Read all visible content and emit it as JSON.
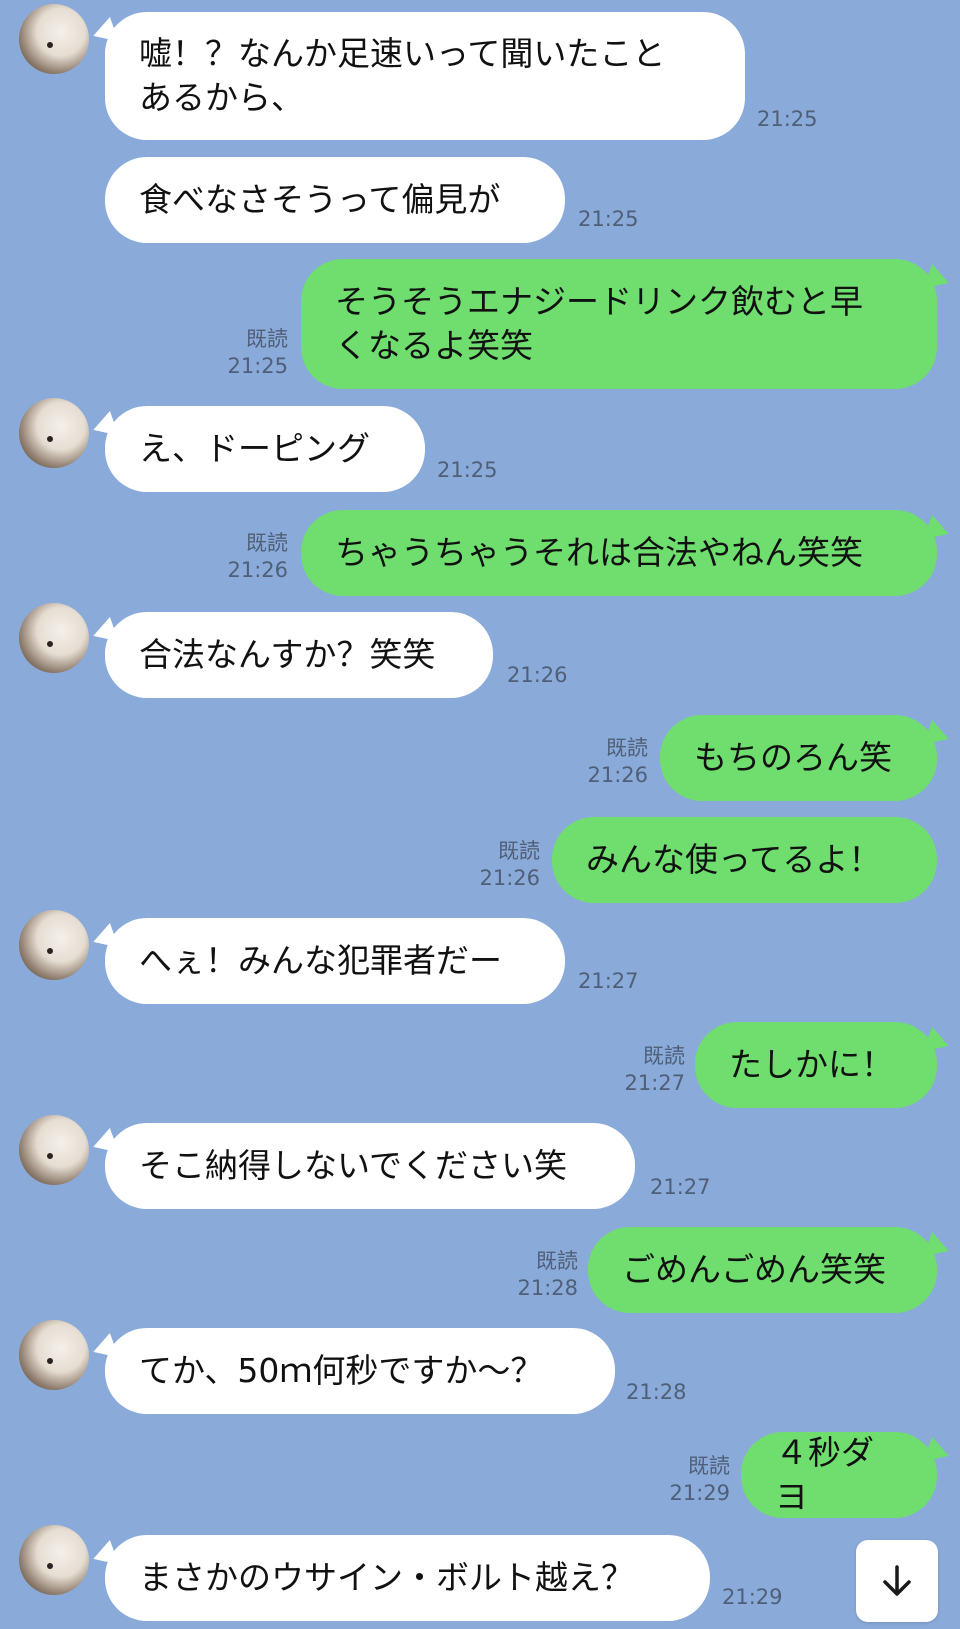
{
  "chat": {
    "messages": [
      {
        "side": "in",
        "text": "嘘！？なんか足速いって聞いたこと\nあるから、",
        "time": "21:25"
      },
      {
        "side": "in",
        "text": "食べなさそうって偏見が",
        "time": "21:25"
      },
      {
        "side": "out",
        "text": "そうそうエナジードリンク飲むと早\nくなるよ笑笑",
        "read": "既読",
        "time": "21:25"
      },
      {
        "side": "in",
        "text": "え、ドーピング",
        "time": "21:25"
      },
      {
        "side": "out",
        "text": "ちゃうちゃうそれは合法やねん笑笑",
        "read": "既読",
        "time": "21:26"
      },
      {
        "side": "in",
        "text": "合法なんすか？笑笑",
        "time": "21:26"
      },
      {
        "side": "out",
        "text": "もちのろん笑",
        "read": "既読",
        "time": "21:26"
      },
      {
        "side": "out",
        "text": "みんな使ってるよ！",
        "read": "既読",
        "time": "21:26"
      },
      {
        "side": "in",
        "text": "へぇ！みんな犯罪者だー",
        "time": "21:27"
      },
      {
        "side": "out",
        "text": "たしかに！",
        "read": "既読",
        "time": "21:27"
      },
      {
        "side": "in",
        "text": "そこ納得しないでください笑",
        "time": "21:27"
      },
      {
        "side": "out",
        "text": "ごめんごめん笑笑",
        "read": "既読",
        "time": "21:28"
      },
      {
        "side": "in",
        "text": "てか、50ｍ何秒ですか〜？",
        "time": "21:28"
      },
      {
        "side": "out",
        "text": "４秒ダヨ",
        "read": "既読",
        "time": "21:29"
      },
      {
        "side": "in",
        "text": "まさかのウサイン・ボルト越え？",
        "time": "21:29"
      }
    ],
    "scroll_icon": "arrow-down-icon"
  },
  "colors": {
    "background": "#8aaad9",
    "incoming_bubble": "#ffffff",
    "outgoing_bubble": "#6fde6e",
    "meta_text": "#4f5f78"
  }
}
